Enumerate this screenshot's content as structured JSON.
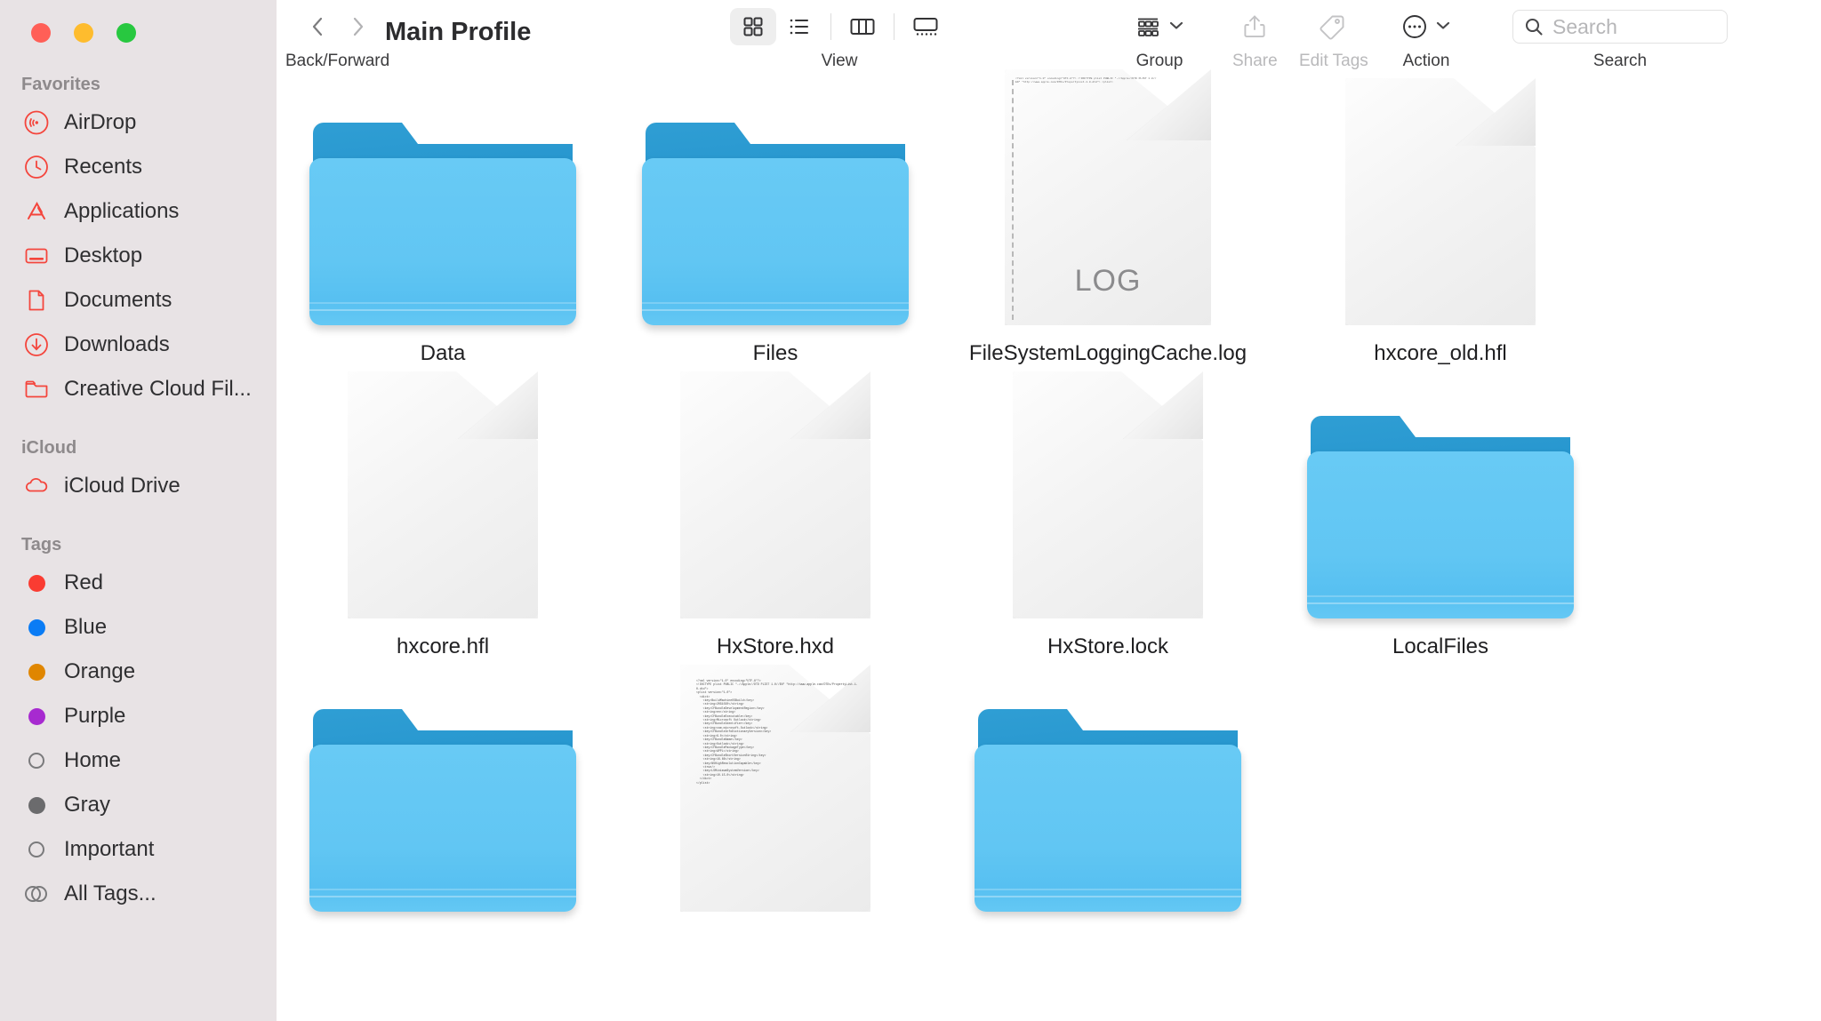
{
  "window": {
    "title": "Main Profile",
    "traffic_lights": [
      "close",
      "minimize",
      "zoom"
    ]
  },
  "sidebar": {
    "sections": [
      {
        "title": "Favorites",
        "items": [
          {
            "label": "AirDrop",
            "icon": "airdrop-icon",
            "color": "#f4453c"
          },
          {
            "label": "Recents",
            "icon": "clock-icon",
            "color": "#f4453c"
          },
          {
            "label": "Applications",
            "icon": "applications-icon",
            "color": "#f4453c"
          },
          {
            "label": "Desktop",
            "icon": "desktop-icon",
            "color": "#f4453c"
          },
          {
            "label": "Documents",
            "icon": "document-icon",
            "color": "#f4453c"
          },
          {
            "label": "Downloads",
            "icon": "download-icon",
            "color": "#f4453c"
          },
          {
            "label": "Creative Cloud Fil...",
            "icon": "folder-icon",
            "color": "#f4453c"
          }
        ]
      },
      {
        "title": "iCloud",
        "items": [
          {
            "label": "iCloud Drive",
            "icon": "cloud-icon",
            "color": "#f4453c"
          }
        ]
      },
      {
        "title": "Tags",
        "items": [
          {
            "label": "Red",
            "icon": "tag-dot-icon",
            "color": "#fa3c32"
          },
          {
            "label": "Blue",
            "icon": "tag-dot-icon",
            "color": "#0a7cf5"
          },
          {
            "label": "Orange",
            "icon": "tag-dot-icon",
            "color": "#e08600"
          },
          {
            "label": "Purple",
            "icon": "tag-dot-icon",
            "color": "#a72ad0"
          },
          {
            "label": "Home",
            "icon": "tag-dot-hollow-icon",
            "color": ""
          },
          {
            "label": "Gray",
            "icon": "tag-dot-icon",
            "color": "#6b6b6d"
          },
          {
            "label": "Important",
            "icon": "tag-dot-hollow-icon",
            "color": ""
          },
          {
            "label": "All Tags...",
            "icon": "all-tags-icon",
            "color": ""
          }
        ]
      }
    ]
  },
  "toolbar": {
    "back_forward_label": "Back/Forward",
    "back_icon": "chevron-left-icon",
    "forward_icon": "chevron-right-icon",
    "view_label": "View",
    "view_modes": [
      {
        "name": "icon-view",
        "icon": "grid-icon",
        "active": true
      },
      {
        "name": "list-view",
        "icon": "list-icon",
        "active": false
      },
      {
        "name": "column-view",
        "icon": "columns-icon",
        "active": false
      },
      {
        "name": "gallery-view",
        "icon": "gallery-icon",
        "active": false
      }
    ],
    "group_label": "Group",
    "group_icon": "group-icon",
    "share_label": "Share",
    "share_icon": "share-icon",
    "share_disabled": true,
    "edit_tags_label": "Edit Tags",
    "edit_tags_icon": "tag-icon",
    "edit_tags_disabled": true,
    "action_label": "Action",
    "action_icon": "ellipsis-circle-icon",
    "search_label": "Search",
    "search_placeholder": "Search",
    "search_value": "",
    "search_icon": "search-icon"
  },
  "files": {
    "rows": [
      [
        {
          "name": "Data",
          "type": "folder",
          "kind": ""
        },
        {
          "name": "Files",
          "type": "folder",
          "kind": ""
        },
        {
          "name": "FileSystemLoggingCache.log",
          "type": "document",
          "kind": "LOG"
        },
        {
          "name": "hxcore_old.hfl",
          "type": "document",
          "kind": ""
        }
      ],
      [
        {
          "name": "hxcore.hfl",
          "type": "document",
          "kind": ""
        },
        {
          "name": "HxStore.hxd",
          "type": "document",
          "kind": ""
        },
        {
          "name": "HxStore.lock",
          "type": "document",
          "kind": ""
        },
        {
          "name": "LocalFiles",
          "type": "folder",
          "kind": ""
        }
      ],
      [
        {
          "name": "",
          "type": "folder",
          "kind": ""
        },
        {
          "name": "",
          "type": "xml-document",
          "kind": ""
        },
        {
          "name": "",
          "type": "folder",
          "kind": ""
        },
        {
          "name": "",
          "type": "empty",
          "kind": ""
        }
      ]
    ],
    "log_preview_text": "<?xml version=\"1.0\" encoding=\"UTF-8\"?> <!DOCTYPE plist PUBLIC \"-//Apple//DTD PLIST 1.0//EN\" \"http://www.apple.com/DTDs/PropertyList-1.0.dtd\"> <plist>",
    "xml_preview_text": "<?xml version=\"1.0\" encoding=\"UTF-8\"?>\n<!DOCTYPE plist PUBLIC \"-//Apple//DTD PLIST 1.0//EN\" \"http://www.apple.com/DTDs/PropertyList-1.0.dtd\">\n<plist version=\"1.0\">\n  <dict>\n    <key>BuildMachineOSBuild</key>\n    <string>20G1020</string>\n    <key>CFBundleDevelopmentRegion</key>\n    <string>en</string>\n    <key>CFBundleExecutable</key>\n    <string>Microsoft Outlook</string>\n    <key>CFBundleIdentifier</key>\n    <string>com.microsoft.Outlook</string>\n    <key>CFBundleInfoDictionaryVersion</key>\n    <string>6.0</string>\n    <key>CFBundleName</key>\n    <string>Outlook</string>\n    <key>CFBundlePackageType</key>\n    <string>APPL</string>\n    <key>CFBundleShortVersionString</key>\n    <string>16.66</string>\n    <key>NSHighResolutionCapable</key>\n    <true/>\n    <key>LSMinimumSystemVersion</key>\n    <string>10.15.0</string>\n  </dict>\n</plist>"
  }
}
